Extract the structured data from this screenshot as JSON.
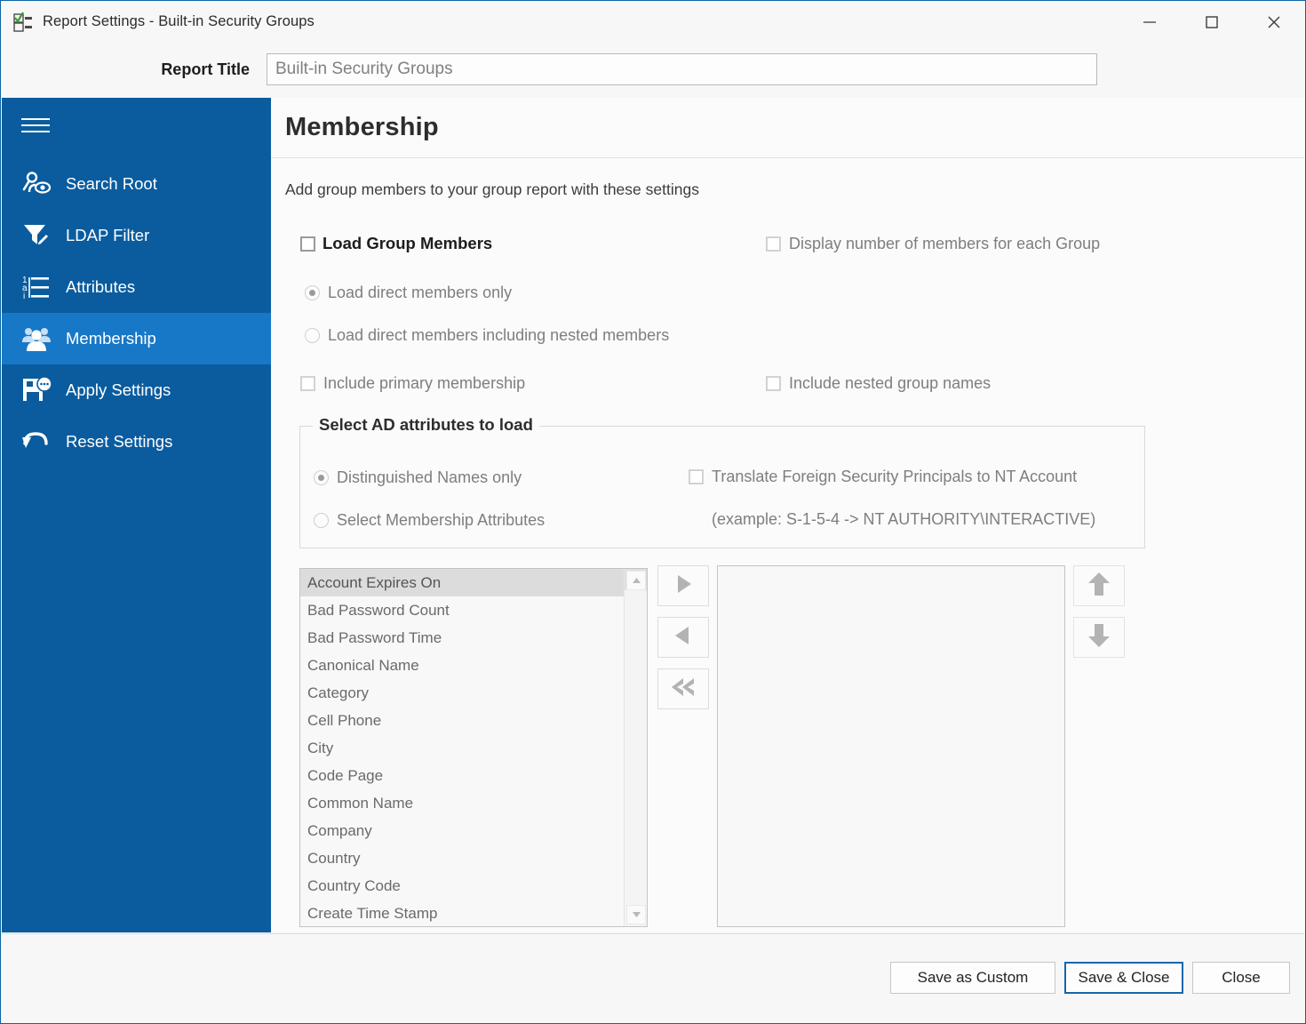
{
  "window": {
    "title": "Report Settings - Built-in Security Groups",
    "app_icon": "checklist-icon",
    "minimize_label": "Minimize",
    "maximize_label": "Maximize",
    "close_label": "Close"
  },
  "report": {
    "label": "Report Title",
    "value": "Built-in Security Groups",
    "placeholder": "Built-in Security Groups"
  },
  "sidebar": {
    "menu_icon": "hamburger-icon",
    "items": [
      {
        "label": "Search Root",
        "icon": "search-root-icon",
        "active": false
      },
      {
        "label": "LDAP Filter",
        "icon": "filter-edit-icon",
        "active": false
      },
      {
        "label": "Attributes",
        "icon": "attributes-list-icon",
        "active": false
      },
      {
        "label": "Membership",
        "icon": "members-group-icon",
        "active": true
      },
      {
        "label": "Apply Settings",
        "icon": "save-apply-icon",
        "active": false
      },
      {
        "label": "Reset Settings",
        "icon": "undo-reset-icon",
        "active": false
      }
    ]
  },
  "page": {
    "title": "Membership",
    "subtitle": "Add group members to your group report with these settings"
  },
  "options": {
    "load_group_members": {
      "label": "Load Group Members",
      "checked": false
    },
    "display_number_of_members": {
      "label": "Display number of members for each Group",
      "checked": false
    },
    "load_direct_only": {
      "label": "Load direct members only",
      "selected": true
    },
    "load_direct_nested": {
      "label": "Load direct members including nested members",
      "selected": false
    },
    "include_primary_membership": {
      "label": "Include primary membership",
      "checked": false
    },
    "include_nested_group_names": {
      "label": "Include nested group names",
      "checked": false
    }
  },
  "attributes_group": {
    "title": "Select AD attributes to load",
    "distinguished_names_only": {
      "label": "Distinguished Names only",
      "selected": true
    },
    "select_membership_attributes": {
      "label": "Select Membership Attributes",
      "selected": false
    },
    "translate_fsp": {
      "label": "Translate Foreign Security Principals to NT Account",
      "checked": false
    },
    "translate_example": "(example: S-1-5-4 -> NT AUTHORITY\\INTERACTIVE)"
  },
  "available_list": {
    "selected_index": 0,
    "items": [
      "Account Expires On",
      "Bad Password Count",
      "Bad Password Time",
      "Canonical Name",
      "Category",
      "Cell Phone",
      "City",
      "Code Page",
      "Common Name",
      "Company",
      "Country",
      "Country Code",
      "Create Time Stamp"
    ]
  },
  "selected_list": {
    "items": []
  },
  "transfer_buttons": [
    {
      "name": "add-button",
      "icon": "triangle-right-icon"
    },
    {
      "name": "remove-button",
      "icon": "triangle-left-icon"
    },
    {
      "name": "remove-all-button",
      "icon": "double-triangle-left-icon"
    }
  ],
  "order_buttons": [
    {
      "name": "move-up-button",
      "icon": "arrow-up-icon"
    },
    {
      "name": "move-down-button",
      "icon": "arrow-down-icon"
    }
  ],
  "footer": {
    "save_as_custom": "Save as Custom",
    "save_and_close": "Save & Close",
    "close": "Close"
  },
  "colors": {
    "sidebar": "#0a5c9e",
    "sidebar_active": "#1878c8",
    "accent": "#1367ac",
    "window_border": "#0a64a4"
  }
}
